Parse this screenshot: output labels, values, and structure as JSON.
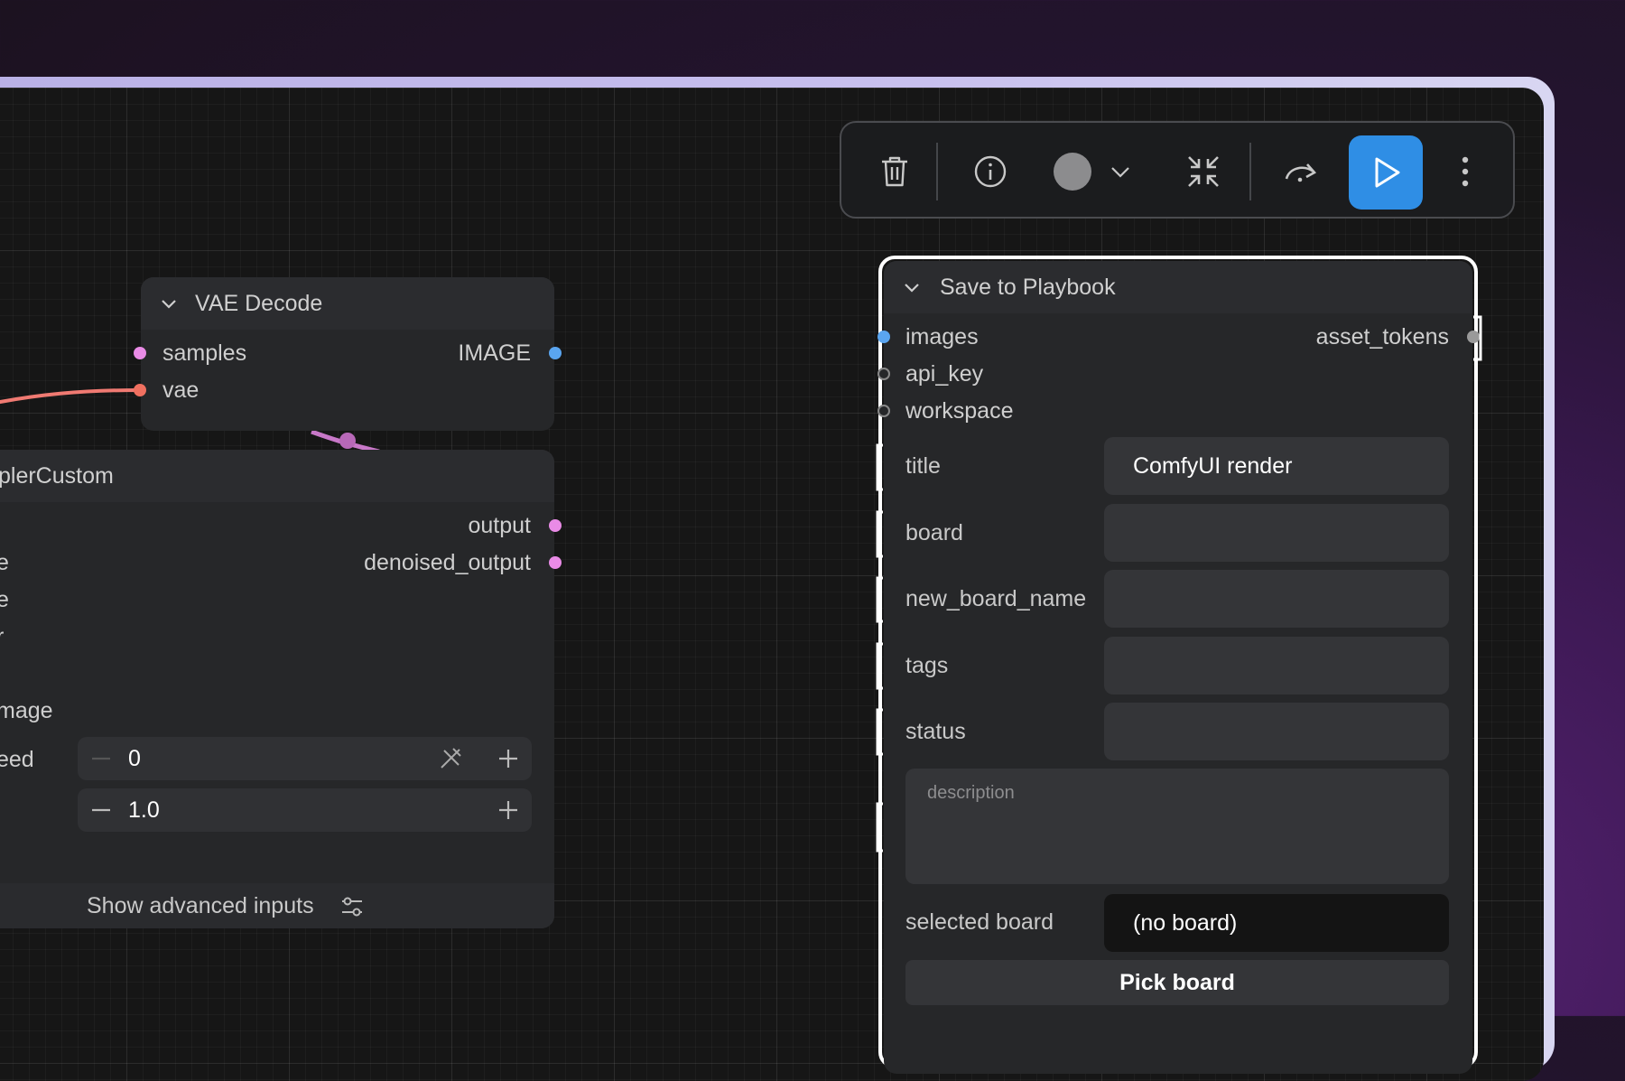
{
  "toolbar": {
    "buttons": [
      {
        "name": "delete",
        "icon": "trash-icon"
      },
      {
        "name": "info",
        "icon": "info-icon"
      },
      {
        "name": "color",
        "icon": "color-circle-icon"
      },
      {
        "name": "collapse",
        "icon": "collapse-arrows-icon"
      },
      {
        "name": "bypass",
        "icon": "redo-arrow-icon"
      },
      {
        "name": "run",
        "icon": "play-icon"
      },
      {
        "name": "more",
        "icon": "more-vertical-icon"
      }
    ],
    "run_color": "#2f8ee5"
  },
  "vae_decode": {
    "title": "VAE Decode",
    "inputs": [
      "samples",
      "vae"
    ],
    "outputs": [
      "IMAGE"
    ]
  },
  "sampler": {
    "title": "plerCustom",
    "outputs": [
      "output",
      "denoised_output"
    ],
    "partial_inputs": [
      "e",
      "e",
      "r",
      "mage"
    ],
    "seed": {
      "label": "eed",
      "value": "0"
    },
    "cfg": {
      "value": "1.0"
    },
    "advanced_label": "Show advanced inputs"
  },
  "playbook": {
    "title": "Save to Playbook",
    "inputs": [
      "images",
      "api_key",
      "workspace"
    ],
    "outputs": [
      "asset_tokens"
    ],
    "fields": [
      {
        "label": "title",
        "value": "ComfyUI render"
      },
      {
        "label": "board",
        "value": ""
      },
      {
        "label": "new_board_name",
        "value": ""
      },
      {
        "label": "tags",
        "value": ""
      },
      {
        "label": "status",
        "value": ""
      }
    ],
    "description_placeholder": "description",
    "selected_board_label": "selected board",
    "selected_board_value": "(no board)",
    "pick_board_label": "Pick board"
  },
  "colors": {
    "image_slot": "#5aa5f0",
    "latent_slot": "#e98be6",
    "vae_slot": "#f07060",
    "wire_vae": "#f07a72",
    "wire_latent": "#d07ad0",
    "selection_border": "#ffffff"
  }
}
